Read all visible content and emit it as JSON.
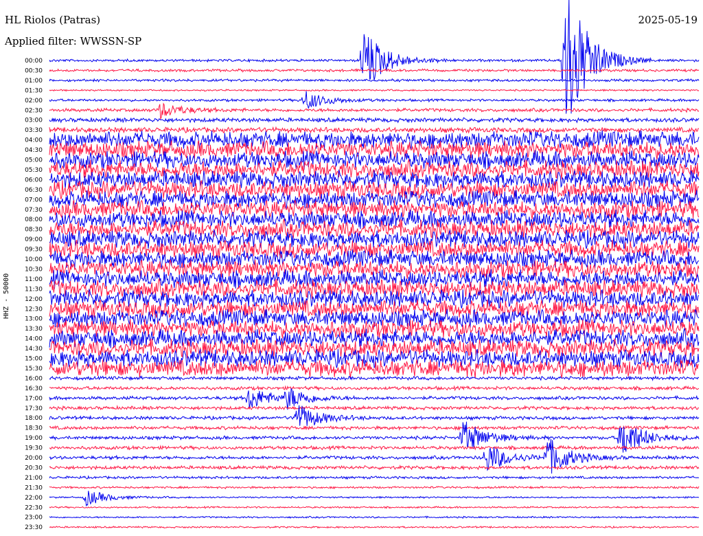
{
  "header": {
    "title": "HL Riolos (Patras)",
    "date": "2025-05-19",
    "filter": "Applied filter: WWSSN-SP"
  },
  "chart_data": {
    "type": "line",
    "title": "HL Riolos (Patras)",
    "date": "2025-05-19",
    "filter": "Applied filter: WWSSN-SP",
    "ylabel": "HHZ - 50000",
    "row_labels": [
      "00:00",
      "00:30",
      "01:00",
      "01:30",
      "02:00",
      "02:30",
      "03:00",
      "03:30",
      "04:00",
      "04:30",
      "05:00",
      "05:30",
      "06:00",
      "06:30",
      "07:00",
      "07:30",
      "08:00",
      "08:30",
      "09:00",
      "09:30",
      "10:00",
      "10:30",
      "11:00",
      "11:30",
      "12:00",
      "12:30",
      "13:00",
      "13:30",
      "14:00",
      "14:30",
      "15:00",
      "15:30",
      "16:00",
      "16:30",
      "17:00",
      "17:30",
      "18:00",
      "18:30",
      "19:00",
      "19:30",
      "20:00",
      "20:30",
      "21:00",
      "21:30",
      "22:00",
      "22:30",
      "23:00",
      "23:30"
    ],
    "colors": [
      "#0000ee",
      "#ff1744"
    ],
    "row_amplitude": [
      0.15,
      0.15,
      0.15,
      0.1,
      0.15,
      0.2,
      0.25,
      0.3,
      1,
      1,
      1,
      1,
      1,
      1,
      1,
      1,
      1,
      1,
      1,
      1,
      1,
      1,
      1,
      1,
      1,
      1,
      1,
      1,
      1,
      1,
      1,
      1,
      0.2,
      0.2,
      0.2,
      0.2,
      0.2,
      0.2,
      0.2,
      0.2,
      0.2,
      0.2,
      0.15,
      0.12,
      0.1,
      0.1,
      0.1,
      0.1
    ],
    "events": [
      {
        "row": 0,
        "minute": 14.5,
        "amplitude": 3.5
      },
      {
        "row": 0,
        "minute": 23.8,
        "amplitude": 9.0
      },
      {
        "row": 4,
        "minute": 11.8,
        "amplitude": 1.0
      },
      {
        "row": 5,
        "minute": 5.1,
        "amplitude": 0.8
      },
      {
        "row": 34,
        "minute": 9.2,
        "amplitude": 1.2
      },
      {
        "row": 34,
        "minute": 11.0,
        "amplitude": 1.0
      },
      {
        "row": 36,
        "minute": 11.4,
        "amplitude": 1.5
      },
      {
        "row": 38,
        "minute": 19.1,
        "amplitude": 1.8
      },
      {
        "row": 38,
        "minute": 26.4,
        "amplitude": 2.2
      },
      {
        "row": 40,
        "minute": 20.2,
        "amplitude": 1.5
      },
      {
        "row": 40,
        "minute": 23.0,
        "amplitude": 2.0
      },
      {
        "row": 44,
        "minute": 1.7,
        "amplitude": 0.8
      }
    ]
  }
}
